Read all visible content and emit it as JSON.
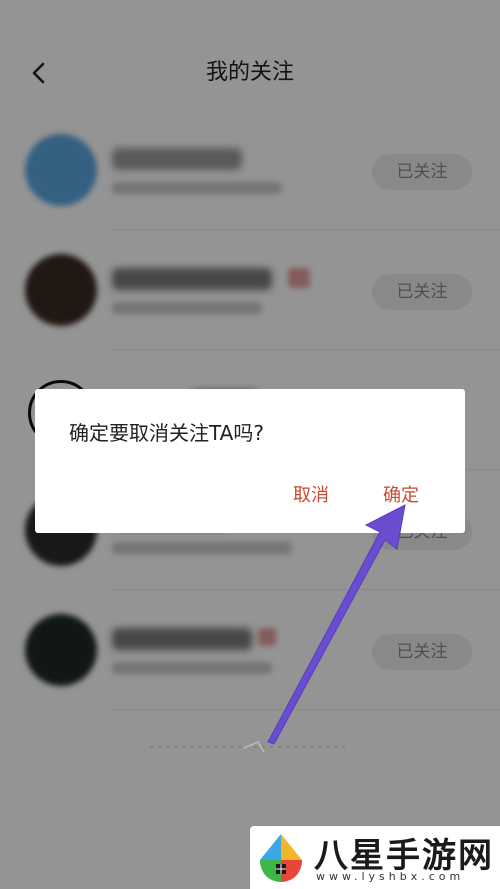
{
  "header": {
    "title": "我的关注",
    "back_icon": "chevron-left-icon"
  },
  "list": {
    "items": [
      {
        "name": "",
        "follow_label": "已关注",
        "avatar_color": "#5aa6e0"
      },
      {
        "name": "",
        "follow_label": "已关注",
        "avatar_color": "#3a2a24"
      },
      {
        "name": "",
        "follow_label": "",
        "avatar_color": "#ffffff"
      },
      {
        "name": "",
        "follow_label": "已关注",
        "avatar_color": "#2a2a2a"
      },
      {
        "name": "",
        "follow_label": "已关注",
        "avatar_color": "#1e2a22"
      }
    ]
  },
  "dialog": {
    "message": "确定要取消关注TA吗?",
    "cancel_label": "取消",
    "confirm_label": "确定"
  },
  "annotation": {
    "arrow_color": "#6a4ccf",
    "arrow_icon": "pointer-arrow-icon"
  },
  "watermark": {
    "name": "八星手游网",
    "url": "www.lyshbx.com",
    "logo_icon": "colorful-shield-logo-icon"
  },
  "colors": {
    "accent": "#c84a30",
    "overlay": "rgba(0,0,0,0.42)"
  }
}
